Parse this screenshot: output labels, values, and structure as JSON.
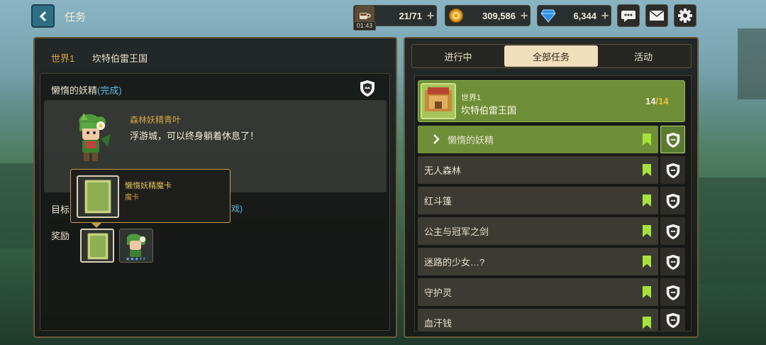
{
  "header": {
    "back_label": "back",
    "title": "任务",
    "stamina": "21/71",
    "stamina_timer": "01:43",
    "gold": "309,586",
    "gems": "6,344",
    "icons": [
      "coffee-icon",
      "coin-icon",
      "gem-icon",
      "chat-icon",
      "mail-icon",
      "settings-icon"
    ]
  },
  "left": {
    "world_label": "世界1",
    "world_name": "坎特伯雷王国",
    "quest_title": "懒惰的妖精",
    "quest_status": "(完成)",
    "npc_name": "森林妖精青叶",
    "npc_line": "浮游城，可以终身躺着休息了！",
    "goal_label": "目标",
    "goal_tail": "戏)",
    "reward_label": "奖励",
    "tooltip": {
      "item_name": "懒惰妖精魔卡",
      "item_type": "魔卡"
    }
  },
  "right": {
    "tabs": [
      {
        "label": "进行中",
        "active": false
      },
      {
        "label": "全部任务",
        "active": true
      },
      {
        "label": "活动",
        "active": false
      }
    ],
    "world": {
      "label": "世界1",
      "name": "坎特伯雷王国",
      "progress_done": "14",
      "progress_sep": "/",
      "progress_total": "14"
    },
    "quests": [
      {
        "label": "懒惰的妖精",
        "active": true
      },
      {
        "label": "无人森林",
        "active": false
      },
      {
        "label": "红斗篷",
        "active": false
      },
      {
        "label": "公主与冠军之剑",
        "active": false
      },
      {
        "label": "迷路的少女…?",
        "active": false
      },
      {
        "label": "守护灵",
        "active": false
      },
      {
        "label": "血汗钱",
        "active": false
      }
    ]
  },
  "colors": {
    "accent_gold": "#d6a548",
    "complete_blue": "#5ab8e0",
    "active_green": "#6f8e38",
    "bookmark_green": "#a6e23a"
  }
}
